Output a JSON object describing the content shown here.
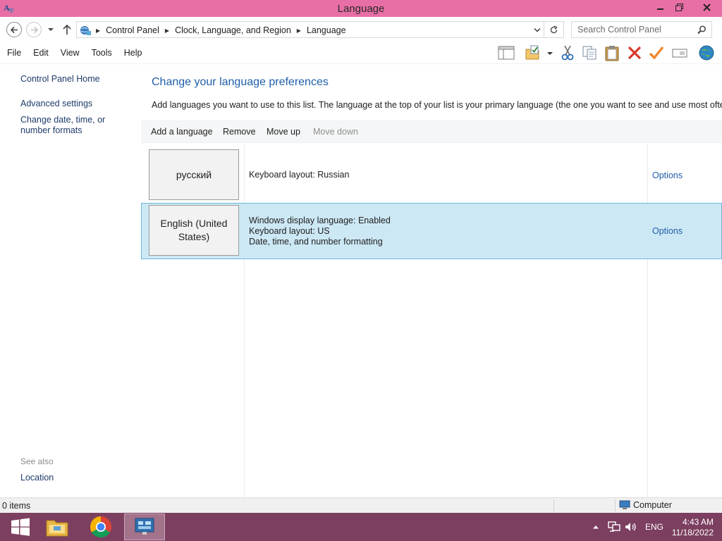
{
  "window": {
    "title": "Language",
    "controls": {
      "minimize": "minimize-icon",
      "restore": "restore-icon",
      "close": "close-icon"
    }
  },
  "address": {
    "breadcrumbs": [
      "Control Panel",
      "Clock, Language, and Region",
      "Language"
    ],
    "search_placeholder": "Search Control Panel"
  },
  "menu": [
    "File",
    "Edit",
    "View",
    "Tools",
    "Help"
  ],
  "toolbar_icons": [
    "preview-pane-icon",
    "folder-check-icon",
    "cut-icon",
    "copy-icon",
    "paste-icon",
    "delete-icon",
    "checkmark-icon",
    "rename-icon",
    "globe-icon"
  ],
  "sidebar": {
    "links": [
      "Control Panel Home",
      "Advanced settings",
      "Change date, time, or number formats"
    ],
    "see_also_heading": "See also",
    "see_also_links": [
      "Location"
    ]
  },
  "main": {
    "heading": "Change your language preferences",
    "description": "Add languages you want to use to this list. The language at the top of your list is your primary language (the one you want to see and use most often).",
    "commands": {
      "add": "Add a language",
      "remove": "Remove",
      "move_up": "Move up",
      "move_down": "Move down"
    },
    "languages": [
      {
        "name": "русский",
        "details": [
          "Keyboard layout: Russian"
        ],
        "options": "Options",
        "selected": false
      },
      {
        "name": "English (United States)",
        "details": [
          "Windows display language: Enabled",
          "Keyboard layout: US",
          "Date, time, and number formatting"
        ],
        "options": "Options",
        "selected": true
      }
    ]
  },
  "statusbar": {
    "items": "0 items",
    "location": "Computer"
  },
  "taskbar": {
    "apps": [
      "windows-start-icon",
      "file-explorer-icon",
      "chrome-icon",
      "control-panel-icon"
    ],
    "tray": {
      "language": "ENG",
      "time": "4:43 AM",
      "date": "11/18/2022"
    }
  },
  "colors": {
    "titlebar": "#e86fa5",
    "taskbar": "#7c3f5f",
    "selection": "#cce8f4",
    "link": "#1f5ea8"
  }
}
